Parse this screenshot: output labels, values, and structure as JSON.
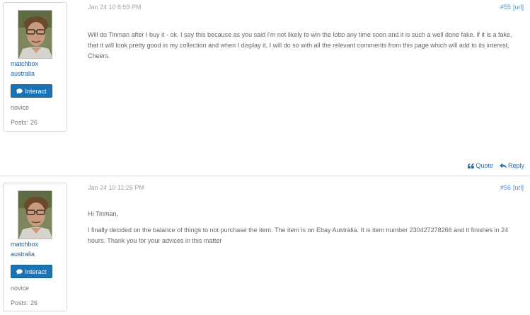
{
  "posts": [
    {
      "user": {
        "name": "matchbox",
        "location": "australia",
        "rank": "novice",
        "posts_label": "Posts:",
        "posts_count": "26",
        "interact_label": "Interact"
      },
      "date": "Jan 24 10 8:59 PM",
      "number": "#55",
      "url_label": "[url]",
      "body": [
        "Will do Tinman after I buy it - ok. I say this because as you said I'm not likely to win the lotto any time soon and it is such a well done fake, if it is a fake, that it will look pretty good in my collection and when I display it, I will do so with all the relevant comments from this page which will add to its interest,",
        "Cheers."
      ],
      "actions": {
        "quote": "Quote",
        "reply": "Reply"
      }
    },
    {
      "user": {
        "name": "matchbox",
        "location": "australia",
        "rank": "novice",
        "posts_label": "Posts:",
        "posts_count": "26",
        "interact_label": "Interact"
      },
      "date": "Jan 24 10 11:26 PM",
      "number": "#56",
      "url_label": "[url]",
      "body": [
        "Hi Tinman,",
        "I finally decided on the balance of things to not purchase the item. The item is on Ebay Australia. It is item number 230427278266 and it finishes in 24 hours. Thank you for your advices in this matter"
      ]
    }
  ],
  "icons": {
    "chat": "chat-bubble-icon",
    "quote": "quote-icon",
    "reply": "reply-arrow-icon"
  },
  "colors": {
    "link": "#1f5f9c",
    "button": "#1a73b5",
    "post_number": "#4a90d0",
    "date": "#a5a5a5"
  }
}
